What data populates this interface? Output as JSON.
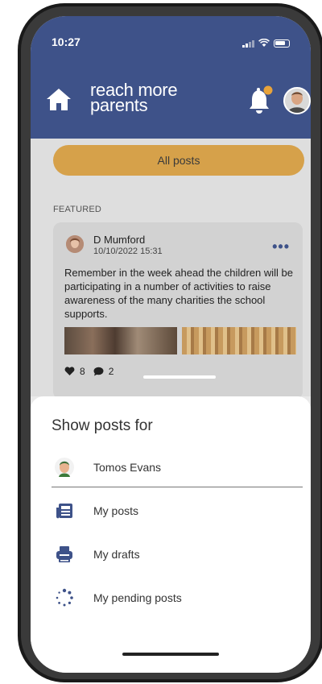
{
  "status_bar": {
    "time": "10:27"
  },
  "header": {
    "logo_line1": "reach more",
    "logo_line2": "parents"
  },
  "feed": {
    "filter_button": "All posts",
    "section_label": "FEATURED",
    "post": {
      "author": "D Mumford",
      "date": "10/10/2022 15:31",
      "text": "Remember in the week ahead the children will be participating in a number of activities to raise awareness of the many charities the school supports.",
      "likes": "8",
      "comments": "2"
    }
  },
  "sheet": {
    "title": "Show posts for",
    "child_name": "Tomos Evans",
    "options": [
      {
        "label": "My posts",
        "icon": "newspaper-icon"
      },
      {
        "label": "My drafts",
        "icon": "printer-icon"
      },
      {
        "label": "My pending posts",
        "icon": "spinner-icon"
      }
    ]
  },
  "colors": {
    "header": "#3e5289",
    "accent": "#d6a14a",
    "icon_blue": "#3e5289",
    "bell_dot": "#e8a33a"
  }
}
